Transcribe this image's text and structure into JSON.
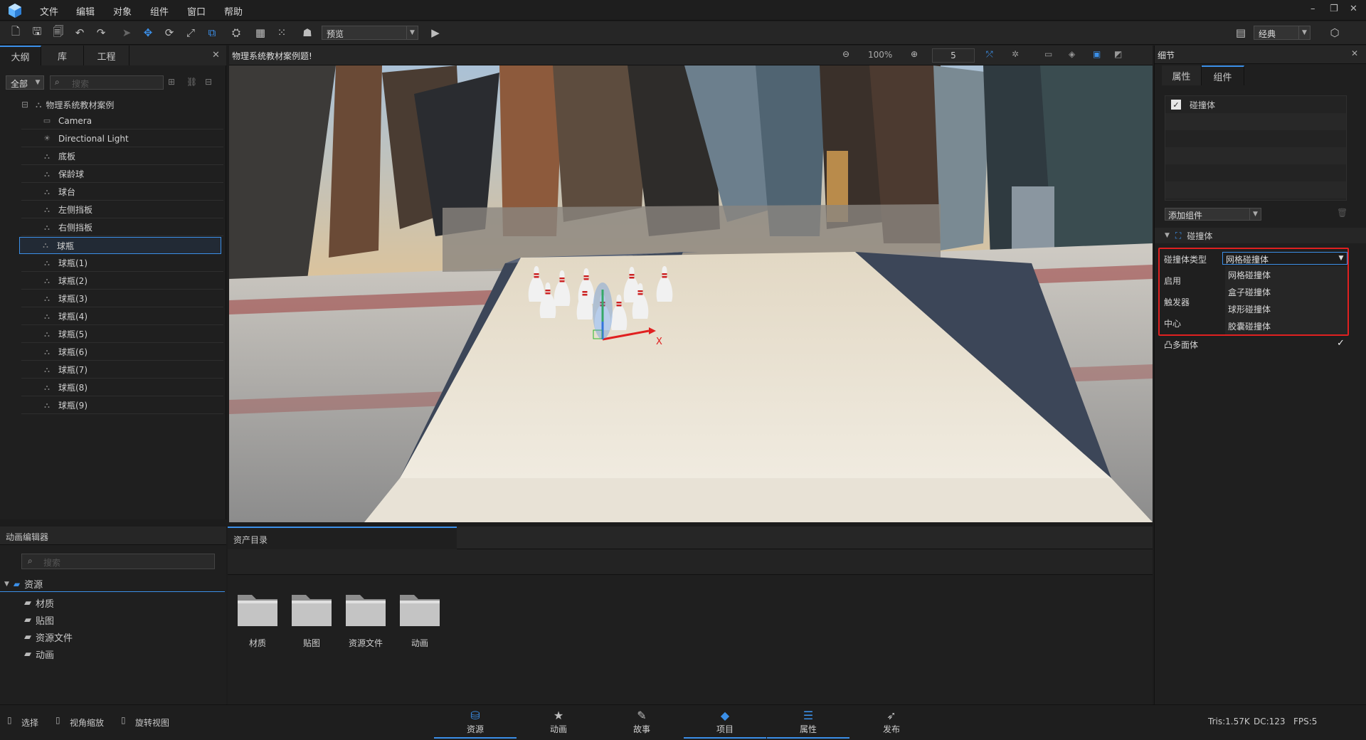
{
  "menubar": {
    "items": [
      "文件",
      "编辑",
      "对象",
      "组件",
      "窗口",
      "帮助"
    ]
  },
  "toolbar": {
    "preview_label": "预览",
    "layout_label": "经典"
  },
  "left": {
    "tabs": [
      "大纲",
      "库",
      "工程"
    ],
    "filter": "全部",
    "search_placeholder": "搜索",
    "root": "物理系统教材案例",
    "items": [
      "Camera",
      "Directional Light",
      "底板",
      "保龄球",
      "球台",
      "左侧挡板",
      "右侧挡板",
      "球瓶",
      "球瓶(1)",
      "球瓶(2)",
      "球瓶(3)",
      "球瓶(4)",
      "球瓶(5)",
      "球瓶(6)",
      "球瓶(7)",
      "球瓶(8)",
      "球瓶(9)"
    ],
    "selected_index": 7
  },
  "viewport": {
    "title": "物理系统教材案例题!",
    "zoom": "100%",
    "step": "5",
    "axis_x": "X"
  },
  "right": {
    "title": "细节",
    "tabs": [
      "属性",
      "组件"
    ],
    "component": "碰撞体",
    "add_component": "添加组件",
    "section": "碰撞体",
    "collider_type_label": "碰撞体类型",
    "collider_type_value": "网格碰撞体",
    "enable_label": "启用",
    "trigger_label": "触发器",
    "center_label": "中心",
    "convex_label": "凸多面体",
    "options": [
      "网格碰撞体",
      "盒子碰撞体",
      "球形碰撞体",
      "胶囊碰撞体"
    ]
  },
  "anim": {
    "title": "动画编辑器",
    "search_placeholder": "搜索",
    "root": "资源",
    "children": [
      "材质",
      "贴图",
      "资源文件",
      "动画"
    ]
  },
  "assets": {
    "title": "资产目录",
    "folders": [
      "材质",
      "贴图",
      "资源文件",
      "动画"
    ]
  },
  "status": {
    "hints": [
      "选择",
      "视角缩放",
      "旋转视图"
    ],
    "tabs": [
      "资源",
      "动画",
      "故事",
      "项目",
      "属性",
      "发布"
    ],
    "tris": "Tris:1.57K",
    "dc": "DC:123",
    "fps": "FPS:5"
  },
  "colors": {
    "accent": "#3b8fe8",
    "highlight": "#e02020"
  }
}
